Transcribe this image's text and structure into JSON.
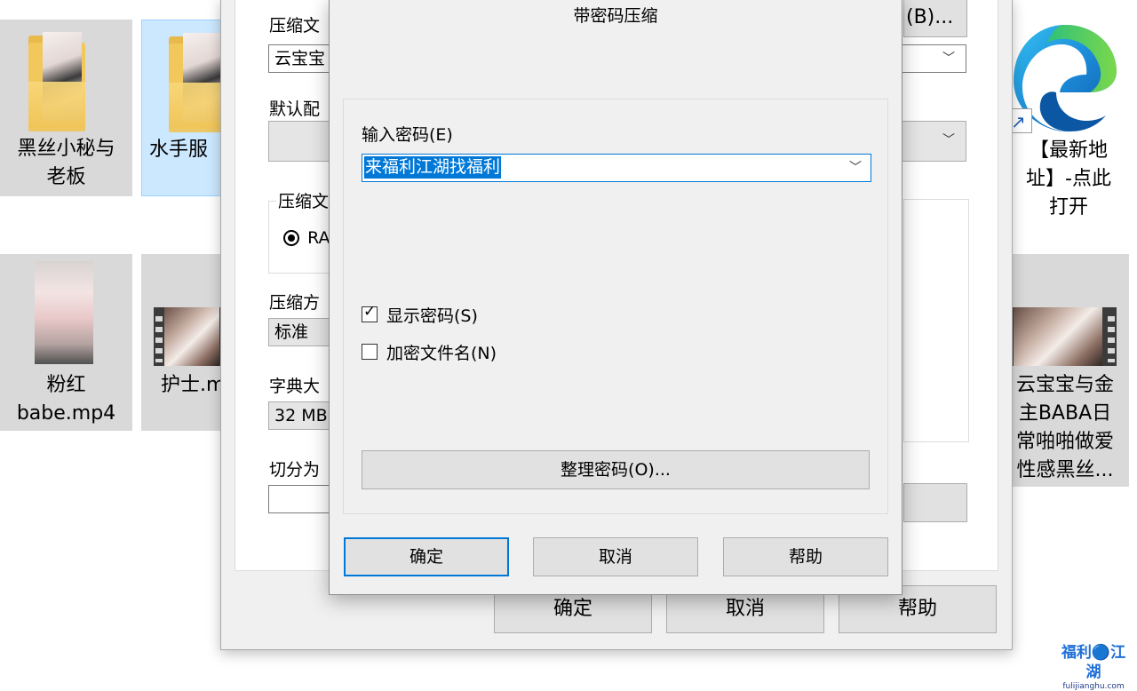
{
  "desktop": {
    "icons": [
      {
        "label": "黑丝小秘与\n老板"
      },
      {
        "label": "水手服"
      },
      {
        "label": "粉红\nbabe.mp4"
      },
      {
        "label": "护士.m"
      },
      {
        "label": "【最新地\n址】-点此\n打开"
      },
      {
        "label": "云宝宝与金\n主BABA日\n常啪啪做爱\n性感黑丝..."
      }
    ]
  },
  "bg_window": {
    "archive_name_label": "压缩文",
    "archive_name_value": "云宝宝",
    "browse_button": "(B)...",
    "profile_label": "默认配",
    "format_label": "压缩文",
    "format_option": "RA",
    "method_label": "压缩方",
    "method_value": "标准",
    "dict_label": "字典大",
    "dict_value": "32 MB",
    "split_label": "切分为",
    "ok": "确定",
    "cancel": "取消",
    "help": "帮助"
  },
  "dialog": {
    "title": "带密码压缩",
    "password_label": "输入密码(E)",
    "password_value": "来福利江湖找福利",
    "show_password": {
      "label": "显示密码(S)",
      "checked": true
    },
    "encrypt_filenames": {
      "label": "加密文件名(N)",
      "checked": false
    },
    "organize_button": "整理密码(O)...",
    "ok": "确定",
    "cancel": "取消",
    "help": "帮助"
  },
  "watermark": {
    "brand": "福利🔵江湖",
    "domain": "fulijianghu.com"
  }
}
